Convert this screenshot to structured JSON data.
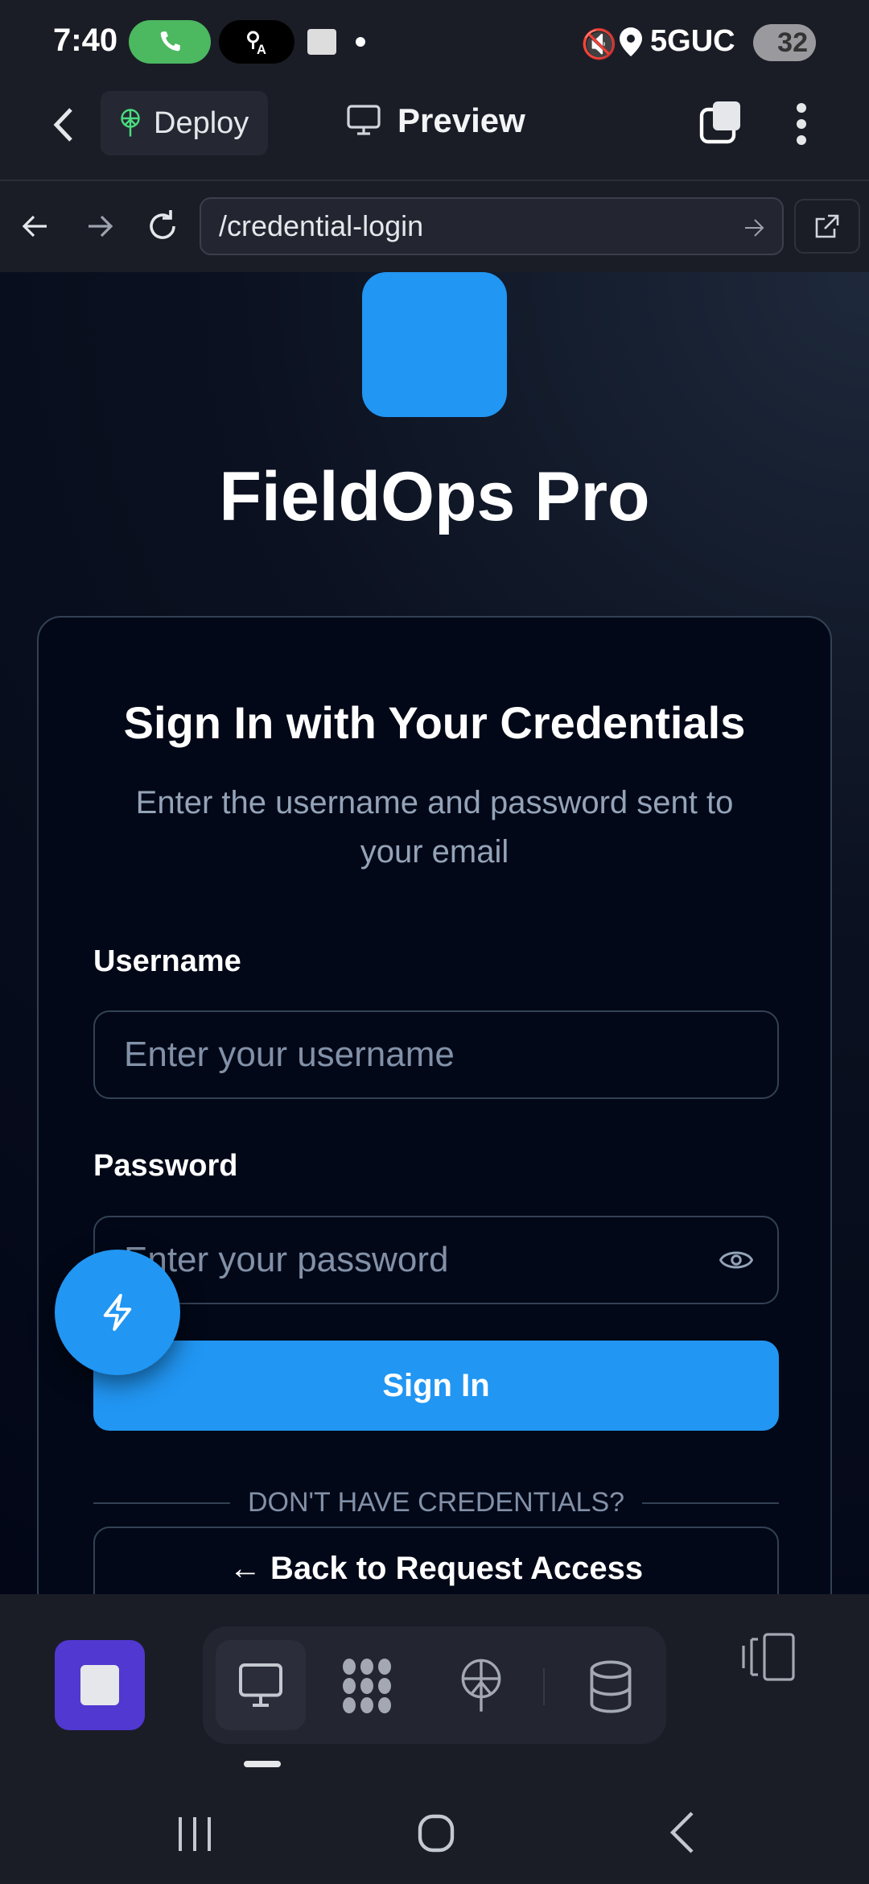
{
  "status_bar": {
    "time": "7:40",
    "network": "5GUC",
    "battery": "32"
  },
  "top_bar": {
    "deploy_label": "Deploy",
    "preview_label": "Preview"
  },
  "url_bar": {
    "url": "/credential-login"
  },
  "page": {
    "app_title": "FieldOps Pro",
    "card_title": "Sign In with Your Credentials",
    "card_subtitle": "Enter the username and password sent to your email",
    "username_label": "Username",
    "username_placeholder": "Enter your username",
    "password_label": "Password",
    "password_placeholder": "Enter your password",
    "sign_in_label": "Sign In",
    "divider_text": "DON'T HAVE CREDENTIALS?",
    "back_label": "← Back to Request Access"
  },
  "colors": {
    "accent": "#2196f3",
    "purple": "#5038d0",
    "background": "#020817"
  }
}
